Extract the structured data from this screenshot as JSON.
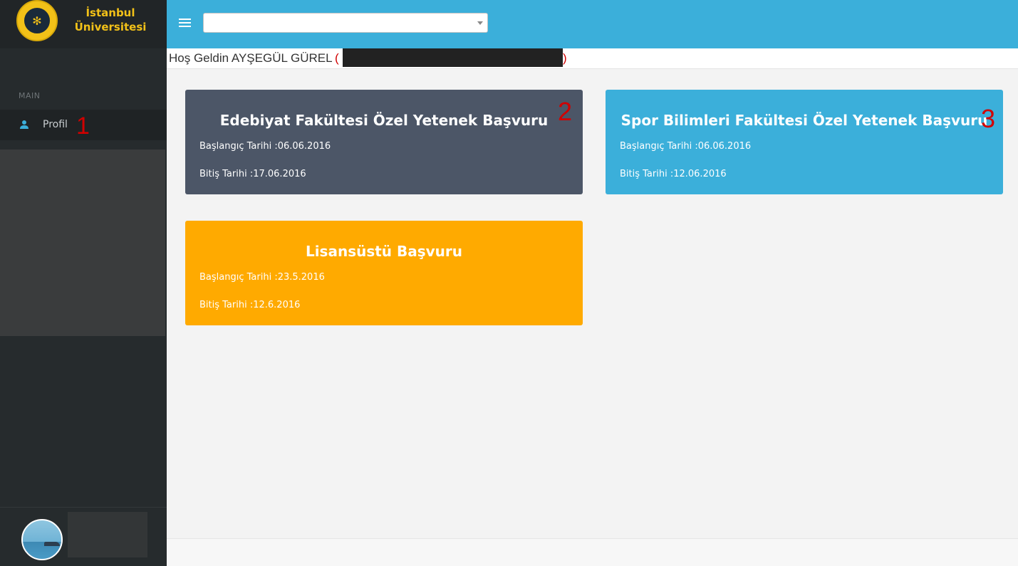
{
  "brand": {
    "line1": "İstanbul",
    "line2": "Üniversitesi"
  },
  "sidebar": {
    "heading": "MAIN",
    "items": [
      {
        "label": "Profil",
        "icon": "user-icon",
        "annotation": "1"
      }
    ]
  },
  "topbar": {
    "select_value": ""
  },
  "welcome": {
    "text": "Hoş Geldin AYŞEGÜL GÜREL",
    "open_paren": "(",
    "close_paren": ")"
  },
  "cards": [
    {
      "title": "Edebiyat Fakültesi Özel Yetenek Başvuru",
      "start": "Başlangıç Tarihi :06.06.2016",
      "end": "Bitiş Tarihi :17.06.2016",
      "annotation": "2",
      "color": "#4c5667"
    },
    {
      "title": "Spor Bilimleri Fakültesi Özel Yetenek Başvuru",
      "start": "Başlangıç Tarihi :06.06.2016",
      "end": "Bitiş Tarihi :12.06.2016",
      "annotation": "3",
      "color": "#3bafda"
    },
    {
      "title": "Lisansüstü Başvuru",
      "start": "Başlangıç Tarihi :23.5.2016",
      "end": "Bitiş Tarihi :12.6.2016",
      "annotation": "",
      "color": "#ffaa00"
    }
  ],
  "colors": {
    "topbar": "#3bafda",
    "sidebar": "#262b2d",
    "brand_text": "#f2c118",
    "annotation": "#d10000"
  }
}
